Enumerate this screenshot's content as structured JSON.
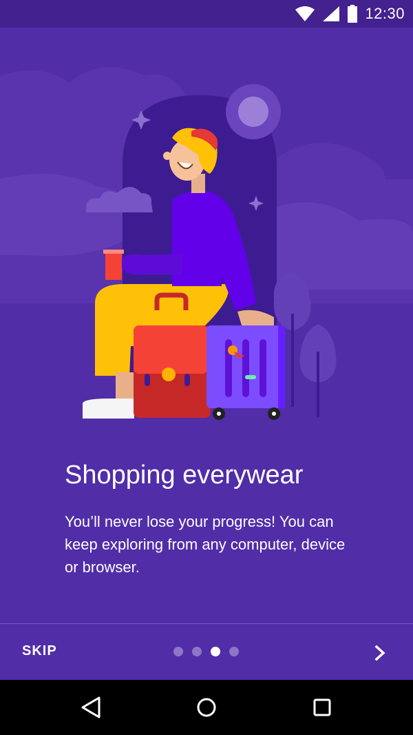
{
  "status_bar": {
    "time": "12:30",
    "icons": [
      "wifi-icon",
      "signal-icon",
      "battery-icon"
    ]
  },
  "onboarding": {
    "title": "Shopping everywear",
    "body": "You’ll never lose your progress! You can keep exploring from any computer, device or browser.",
    "page_count": 4,
    "current_page": 3
  },
  "footer": {
    "skip_label": "SKIP",
    "next_icon": "chevron-right-icon"
  },
  "nav_bar": {
    "buttons": [
      "back-triangle-icon",
      "home-circle-icon",
      "recents-square-icon"
    ]
  },
  "colors": {
    "background": "#512DA8",
    "status_bar": "#43218F",
    "arch": "#3D1C91",
    "text": "#FFFFFF"
  }
}
